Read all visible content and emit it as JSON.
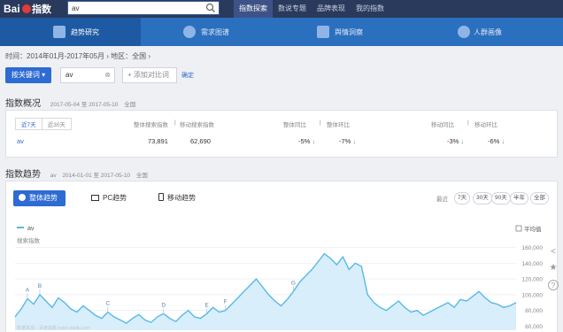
{
  "header": {
    "search_value": "av",
    "nav": [
      "指数探索",
      "数说专题",
      "品牌表现",
      "我的指数"
    ],
    "nav_active": 0
  },
  "tabs": [
    {
      "label": "趋势研究"
    },
    {
      "label": "需求图谱"
    },
    {
      "label": "舆情洞察"
    },
    {
      "label": "人群画像"
    }
  ],
  "filter": {
    "text": "时间：2014年01月-2017年05月 › 地区：全国 ›"
  },
  "keyword_bar": {
    "button_label": "按关键词 ▾",
    "keyword": "av",
    "add_compare": "+ 添加对比词",
    "confirm": "确定"
  },
  "overview": {
    "title": "指数概况",
    "date_range": "2017-05-04 至 2017-05-10",
    "region": "全国",
    "period_tabs": [
      "近7天",
      "近30天"
    ],
    "col_headers": {
      "overall": "整体搜索指数",
      "mobile": "移动搜索指数",
      "yoy": "整体同比",
      "mom": "整体环比",
      "mobile_yoy": "移动同比",
      "mobile_mom": "移动环比",
      "sep": "|"
    },
    "row": {
      "keyword": "av",
      "overall": "73,891",
      "mobile": "62,690",
      "yoy": "-5%",
      "mom": "-7%",
      "mobile_yoy": "-3%",
      "mobile_mom": "-6%",
      "arrow": "↓"
    }
  },
  "trend": {
    "title": "指数趋势",
    "keyword": "av",
    "date_range": "2014-01-01 至 2017-05-10",
    "region": "全国",
    "tabs": [
      "整体趋势",
      "PC趋势",
      "移动趋势"
    ],
    "recent_label": "最近",
    "ranges": [
      "7天",
      "30天",
      "90天",
      "半年",
      "全部"
    ]
  },
  "chart_data": {
    "type": "area",
    "legend": [
      "av"
    ],
    "ylabel": "搜索指数",
    "avg_label": "平均值",
    "yticks": [
      "160,000",
      "140,000",
      "120,000",
      "100,000",
      "80,000",
      "60,000"
    ],
    "ylim": [
      55000,
      165000
    ],
    "values": [
      72000,
      82000,
      95000,
      88000,
      100000,
      92000,
      84000,
      96000,
      90000,
      82000,
      78000,
      86000,
      80000,
      74000,
      70000,
      78000,
      72000,
      68000,
      64000,
      70000,
      75000,
      68000,
      65000,
      72000,
      76000,
      70000,
      66000,
      74000,
      80000,
      72000,
      70000,
      76000,
      84000,
      78000,
      80000,
      88000,
      96000,
      104000,
      112000,
      120000,
      110000,
      100000,
      92000,
      86000,
      94000,
      104000,
      116000,
      124000,
      132000,
      142000,
      152000,
      146000,
      138000,
      148000,
      132000,
      140000,
      136000,
      100000,
      90000,
      84000,
      80000,
      86000,
      92000,
      84000,
      78000,
      80000,
      74000,
      78000,
      82000,
      86000,
      90000,
      84000,
      94000,
      92000,
      98000,
      104000,
      96000,
      90000,
      88000,
      84000,
      86000,
      90000
    ],
    "annotations": [
      "A",
      "B",
      "C",
      "D",
      "E",
      "F",
      "G"
    ],
    "watermark": "数据来源：百度指数 index.baidu.com"
  },
  "icons": {
    "search": "search-icon",
    "share": "share-icon",
    "star": "star-icon",
    "help": "help-icon"
  },
  "colors": {
    "accent": "#2e6bd3",
    "series": "#57b8e8",
    "topbar": "#2a3a5c",
    "navbar": "#2b6fbf"
  }
}
